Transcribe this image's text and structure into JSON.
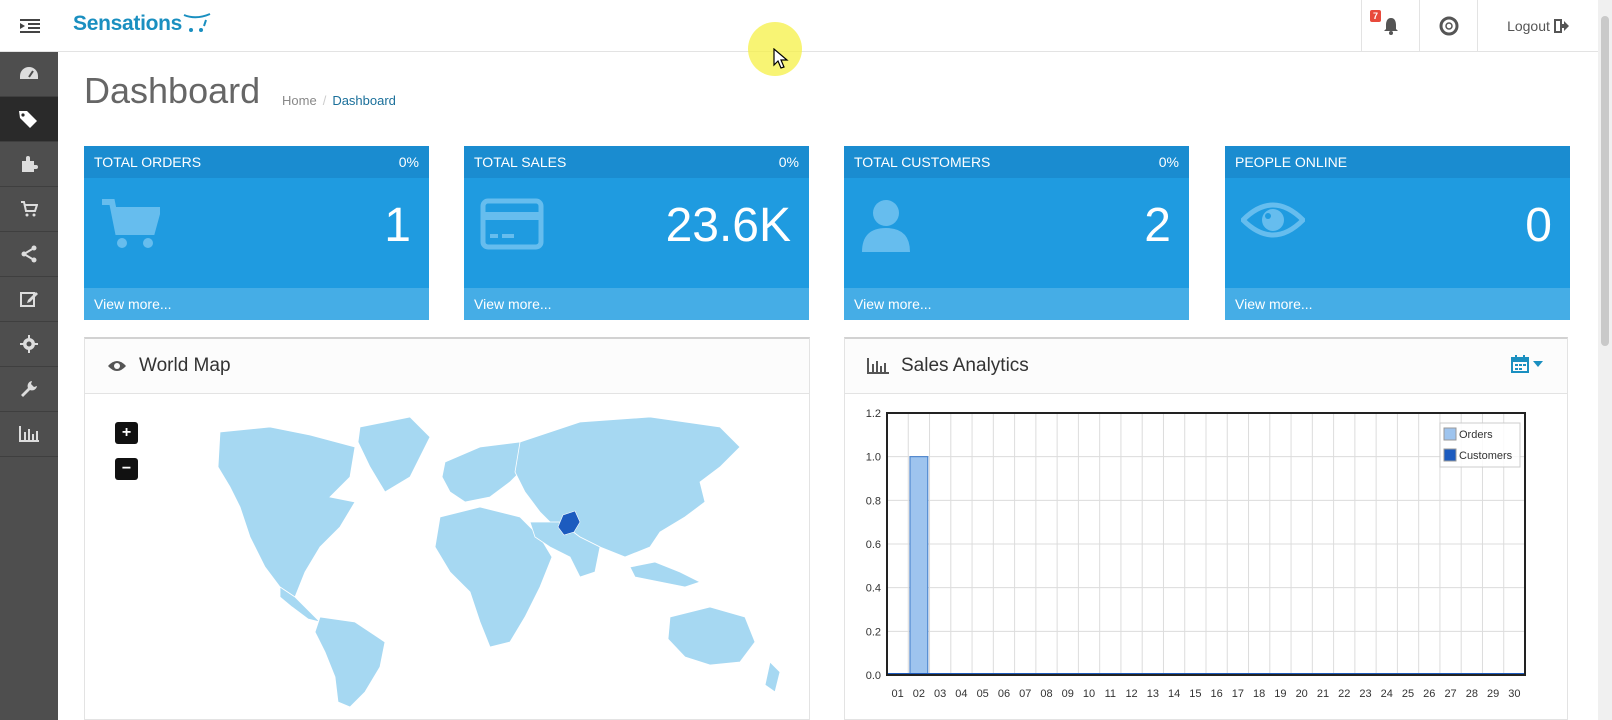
{
  "topbar": {
    "brand": "Sensations",
    "notification_count": "7",
    "logout_label": "Logout"
  },
  "sidebar": {
    "items": [
      {
        "icon": "dashboard-icon"
      },
      {
        "icon": "tags-icon",
        "active": true
      },
      {
        "icon": "puzzle-icon"
      },
      {
        "icon": "cart-icon"
      },
      {
        "icon": "share-icon"
      },
      {
        "icon": "edit-icon"
      },
      {
        "icon": "gear-icon"
      },
      {
        "icon": "wrench-icon"
      },
      {
        "icon": "bar-chart-icon"
      }
    ]
  },
  "page": {
    "title": "Dashboard",
    "breadcrumb_home": "Home",
    "breadcrumb_current": "Dashboard"
  },
  "tiles": [
    {
      "title": "TOTAL ORDERS",
      "percent": "0%",
      "value": "1",
      "link": "View more...",
      "icon": "cart-icon"
    },
    {
      "title": "TOTAL SALES",
      "percent": "0%",
      "value": "23.6K",
      "link": "View more...",
      "icon": "credit-card-icon"
    },
    {
      "title": "TOTAL CUSTOMERS",
      "percent": "0%",
      "value": "2",
      "link": "View more...",
      "icon": "user-icon"
    },
    {
      "title": "PEOPLE ONLINE",
      "percent": "",
      "value": "0",
      "link": "View more...",
      "icon": "eye-icon"
    }
  ],
  "world_map": {
    "title": "World Map",
    "zoom_in": "+",
    "zoom_out": "−",
    "colors": {
      "land": "#a6d8f2",
      "highlight": "#1c5bbf"
    }
  },
  "sales_analytics": {
    "title": "Sales Analytics"
  },
  "chart_data": {
    "type": "bar",
    "categories": [
      "01",
      "02",
      "03",
      "04",
      "05",
      "06",
      "07",
      "08",
      "09",
      "10",
      "11",
      "12",
      "13",
      "14",
      "15",
      "16",
      "17",
      "18",
      "19",
      "20",
      "21",
      "22",
      "23",
      "24",
      "25",
      "26",
      "27",
      "28",
      "29",
      "30"
    ],
    "series": [
      {
        "name": "Orders",
        "color": "#9ec4ee",
        "values": [
          0,
          1,
          0,
          0,
          0,
          0,
          0,
          0,
          0,
          0,
          0,
          0,
          0,
          0,
          0,
          0,
          0,
          0,
          0,
          0,
          0,
          0,
          0,
          0,
          0,
          0,
          0,
          0,
          0,
          0
        ]
      },
      {
        "name": "Customers",
        "color": "#1c5bbf",
        "values": [
          0,
          0,
          0,
          0,
          0,
          0,
          0,
          0,
          0,
          0,
          0,
          0,
          0,
          0,
          0,
          0,
          0,
          0,
          0,
          0,
          0,
          0,
          0,
          0,
          0,
          0,
          0,
          0,
          0,
          0
        ]
      }
    ],
    "ylim": [
      0,
      1.2
    ],
    "yticks": [
      "0.0",
      "0.2",
      "0.4",
      "0.6",
      "0.8",
      "1.0",
      "1.2"
    ],
    "grid": true,
    "legend": "top-right"
  }
}
